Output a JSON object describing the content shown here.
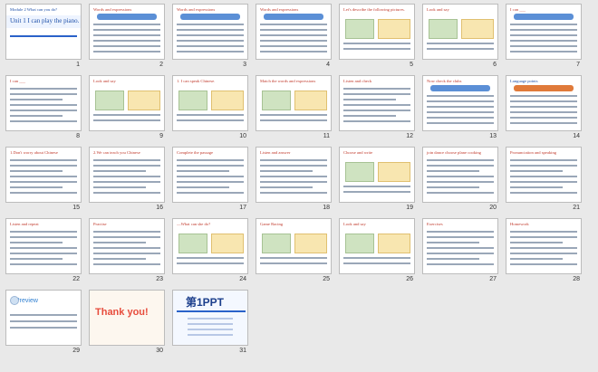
{
  "slides": [
    {
      "n": "1",
      "title": "Module 2 What can you do?",
      "sub": "Unit 1 I can play the piano.",
      "style": "title"
    },
    {
      "n": "2",
      "title": "Words and expressions",
      "style": "table"
    },
    {
      "n": "3",
      "title": "Words and expressions",
      "style": "table"
    },
    {
      "n": "4",
      "title": "Words and expressions",
      "style": "table"
    },
    {
      "n": "5",
      "title": "Let's describe the following pictures.",
      "sub": "—What's he doing?",
      "style": "pics"
    },
    {
      "n": "6",
      "title": "Look and say",
      "style": "pics"
    },
    {
      "n": "7",
      "title": "I can ___",
      "style": "table"
    },
    {
      "n": "8",
      "title": "I can ___",
      "style": "text"
    },
    {
      "n": "9",
      "title": "Look and say",
      "style": "pics"
    },
    {
      "n": "10",
      "title": "1. I can speak Chinese.",
      "style": "pics"
    },
    {
      "n": "11",
      "title": "Match the words and expressions",
      "style": "pics"
    },
    {
      "n": "12",
      "title": "Listen and check",
      "style": "text"
    },
    {
      "n": "13",
      "title": "Now check the clubs",
      "style": "table"
    },
    {
      "n": "14",
      "title": "Language points",
      "style": "lang"
    },
    {
      "n": "15",
      "title": "1.Don't worry about Chinese",
      "style": "text"
    },
    {
      "n": "16",
      "title": "2.We can teach you Chinese",
      "style": "text"
    },
    {
      "n": "17",
      "title": "Complete the passage",
      "style": "text"
    },
    {
      "n": "18",
      "title": "Listen and answer",
      "style": "text"
    },
    {
      "n": "19",
      "title": "Choose and write",
      "style": "pics"
    },
    {
      "n": "20",
      "title": "join dance choose plane cooking",
      "style": "text"
    },
    {
      "n": "21",
      "title": "Pronunciation and speaking",
      "style": "text"
    },
    {
      "n": "22",
      "title": "Listen and repeat",
      "style": "text"
    },
    {
      "n": "23",
      "title": "Practise",
      "style": "text"
    },
    {
      "n": "24",
      "title": "—What can she do?",
      "style": "pics"
    },
    {
      "n": "25",
      "title": "Game Racing",
      "style": "pics"
    },
    {
      "n": "26",
      "title": "Look and say",
      "style": "pics"
    },
    {
      "n": "27",
      "title": "Exercises",
      "style": "text"
    },
    {
      "n": "28",
      "title": "Homework",
      "style": "text"
    },
    {
      "n": "29",
      "title": "Preview",
      "style": "preview"
    },
    {
      "n": "30",
      "title": "Thank you!",
      "style": "thank"
    },
    {
      "n": "31",
      "title": "第1PPT",
      "style": "brand"
    }
  ]
}
